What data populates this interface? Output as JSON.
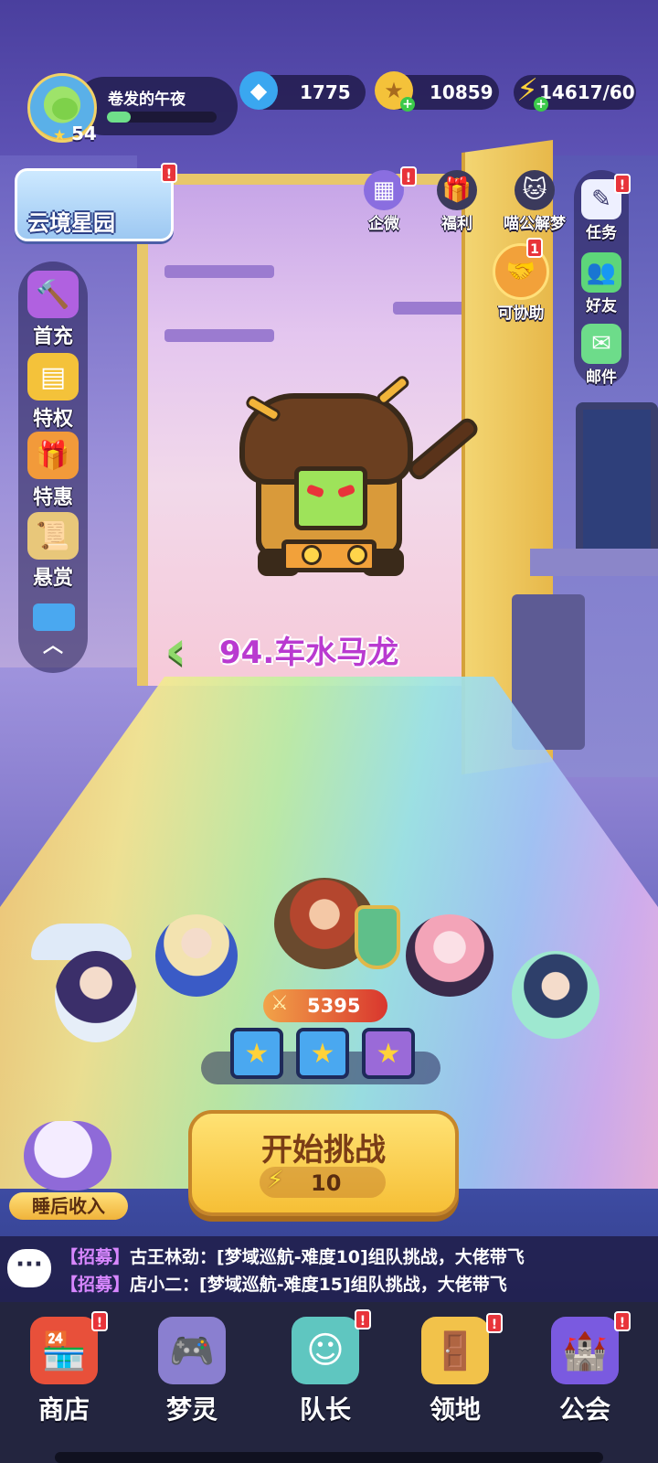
{
  "player": {
    "name": "卷发的午夜",
    "level": "54",
    "exp_progress": 0.22
  },
  "resources": {
    "diamonds": "1775",
    "coins": "10859",
    "energy": "14617/60"
  },
  "star_garden": {
    "label": "云境星园",
    "badge": "!"
  },
  "top_buttons": [
    {
      "label": "企微",
      "icon": "gift-box-icon",
      "badge": "!"
    },
    {
      "label": "福利",
      "icon": "gift-bag-icon"
    },
    {
      "label": "喵公解梦",
      "icon": "cat-icon"
    }
  ],
  "assist": {
    "label": "可协助",
    "icon": "handshake-icon",
    "badge": "1"
  },
  "right_menu": [
    {
      "label": "任务",
      "icon": "task-icon",
      "badge": "!"
    },
    {
      "label": "好友",
      "icon": "friends-icon"
    },
    {
      "label": "邮件",
      "icon": "mail-icon"
    }
  ],
  "left_menu": [
    {
      "label": "首充",
      "icon": "hammer-icon"
    },
    {
      "label": "特权",
      "icon": "privilege-card-icon"
    },
    {
      "label": "特惠",
      "icon": "gift-box-eyes-icon"
    },
    {
      "label": "悬赏",
      "icon": "wanted-scroll-icon"
    }
  ],
  "stage": {
    "title": "94.车水马龙"
  },
  "team": {
    "power": "5395"
  },
  "challenge": {
    "label": "开始挑战",
    "cost": "10"
  },
  "sleep_income": {
    "label": "睡后收入"
  },
  "chat": [
    {
      "tag": "【招募】",
      "text": "古王林劲：[梦域巡航-难度10]组队挑战，大佬带飞"
    },
    {
      "tag": "【招募】",
      "text": "店小二：[梦域巡航-难度15]组队挑战，大佬带飞"
    }
  ],
  "bottom_nav": [
    {
      "label": "商店",
      "icon": "shop-icon",
      "badge": "!"
    },
    {
      "label": "梦灵",
      "icon": "dream-spirit-icon"
    },
    {
      "label": "队长",
      "icon": "captain-icon",
      "badge": "!"
    },
    {
      "label": "领地",
      "icon": "territory-icon",
      "badge": "!"
    },
    {
      "label": "公会",
      "icon": "guild-icon",
      "badge": "!"
    }
  ],
  "colors": {
    "accent_gold": "#f6bf36",
    "stage_title": "#b93ad0",
    "badge_red": "#e8343a",
    "exp_green": "#6fe08a"
  }
}
